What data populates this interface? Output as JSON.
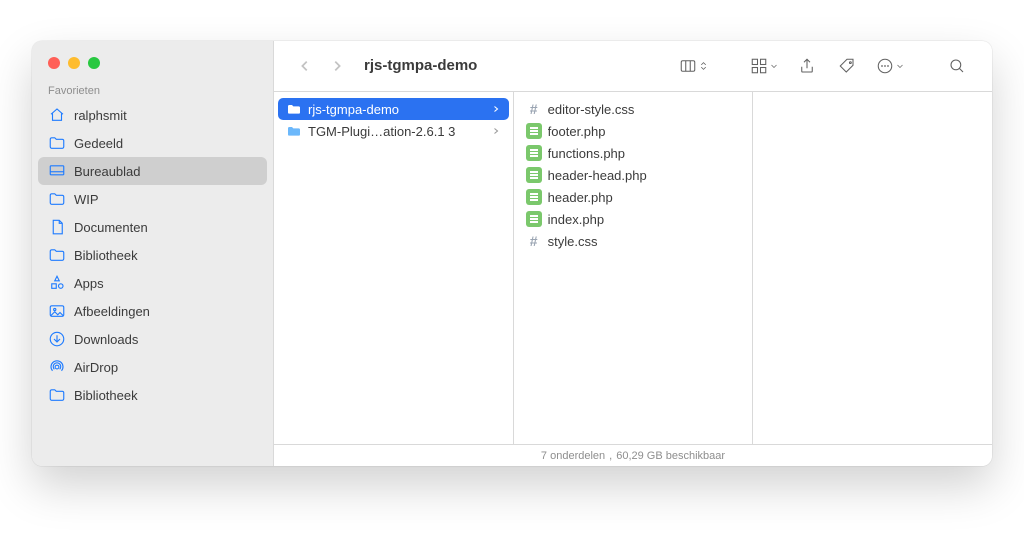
{
  "window": {
    "title": "rjs-tgmpa-demo"
  },
  "sidebar": {
    "section_label": "Favorieten",
    "items": [
      {
        "label": "ralphsmit",
        "icon": "home",
        "selected": false
      },
      {
        "label": "Gedeeld",
        "icon": "folder",
        "selected": false
      },
      {
        "label": "Bureaublad",
        "icon": "desktop",
        "selected": true
      },
      {
        "label": "WIP",
        "icon": "folder",
        "selected": false
      },
      {
        "label": "Documenten",
        "icon": "document",
        "selected": false
      },
      {
        "label": "Bibliotheek",
        "icon": "folder",
        "selected": false
      },
      {
        "label": "Apps",
        "icon": "apps",
        "selected": false
      },
      {
        "label": "Afbeeldingen",
        "icon": "image",
        "selected": false
      },
      {
        "label": "Downloads",
        "icon": "download",
        "selected": false
      },
      {
        "label": "AirDrop",
        "icon": "airdrop",
        "selected": false
      },
      {
        "label": "Bibliotheek",
        "icon": "folder",
        "selected": false
      }
    ]
  },
  "columns": [
    {
      "items": [
        {
          "name": "rjs-tgmpa-demo",
          "type": "folder",
          "selected": true,
          "has_children": true
        },
        {
          "name": "TGM-Plugi…ation-2.6.1 3",
          "type": "folder",
          "selected": false,
          "has_children": true
        }
      ]
    },
    {
      "items": [
        {
          "name": "editor-style.css",
          "type": "css",
          "selected": false
        },
        {
          "name": "footer.php",
          "type": "php",
          "selected": false
        },
        {
          "name": "functions.php",
          "type": "php",
          "selected": false
        },
        {
          "name": "header-head.php",
          "type": "php",
          "selected": false
        },
        {
          "name": "header.php",
          "type": "php",
          "selected": false
        },
        {
          "name": "index.php",
          "type": "php",
          "selected": false
        },
        {
          "name": "style.css",
          "type": "css",
          "selected": false
        }
      ]
    },
    {
      "items": []
    }
  ],
  "status": {
    "item_count": "7 onderdelen",
    "separator": ", ",
    "space_available": "60,29 GB beschikbaar"
  }
}
